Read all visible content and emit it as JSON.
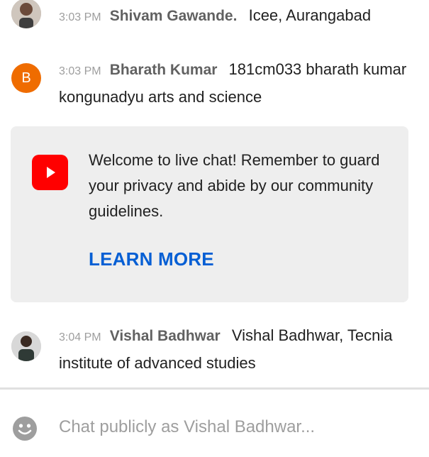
{
  "messages": [
    {
      "time": "3:03 PM",
      "author": "Shivam Gawande.",
      "text": "Icee, Aurangabad",
      "avatar": "photo-avatar"
    },
    {
      "time": "3:03 PM",
      "author": "Bharath Kumar",
      "text": "181cm033 bharath kumar kongunadyu arts and science",
      "avatar_letter": "B",
      "avatar_color": "#ef6c00"
    },
    {
      "time": "3:04 PM",
      "author": "Vishal Badhwar",
      "text": "Vishal Badhwar, Tecnia institute of advanced studies",
      "avatar": "photo-avatar"
    }
  ],
  "banner": {
    "icon": "youtube-icon",
    "text": "Welcome to live chat! Remember to guard your privacy and abide by our community guidelines.",
    "link_label": "LEARN MORE",
    "link_color": "#065fd4",
    "icon_color": "#ff0000"
  },
  "input": {
    "placeholder": "Chat publicly as Vishal Badhwar...",
    "icon": "smiley-icon"
  }
}
